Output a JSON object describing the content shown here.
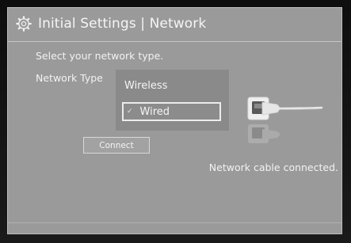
{
  "header": {
    "icon": "gear-icon",
    "title": "Initial Settings | Network"
  },
  "main": {
    "prompt": "Select your network type.",
    "network_type_label": "Network Type",
    "options": [
      {
        "label": "Wireless",
        "selected": false
      },
      {
        "label": "Wired",
        "selected": true
      }
    ],
    "check_mark": "✓",
    "connect_label": "Connect",
    "status": "Network cable connected.",
    "illustration_icon": "network-cable-icon"
  },
  "colors": {
    "panel_background": "#9a9a9a",
    "text": "#f2f2f2",
    "selection_border": "#ececec"
  }
}
